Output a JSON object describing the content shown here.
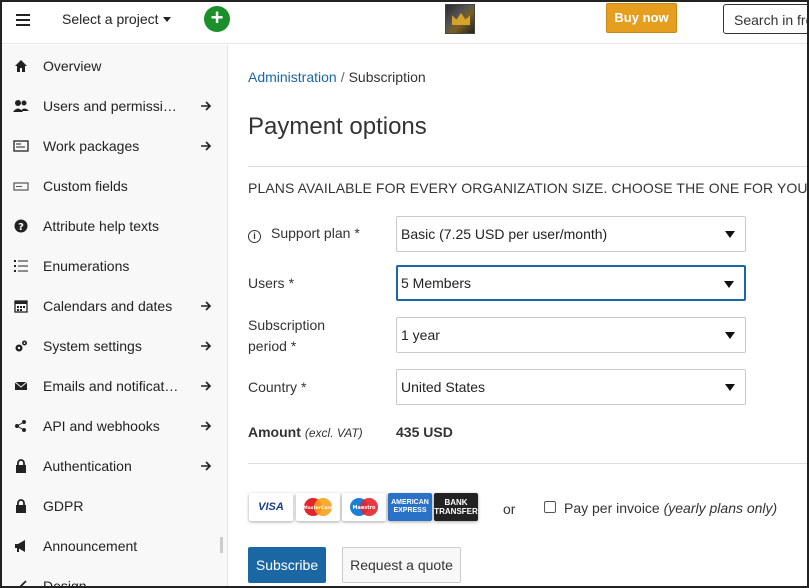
{
  "header": {
    "project_select_label": "Select a project",
    "buy_now_label": "Buy now",
    "search_text": "Search in fre",
    "colors": {
      "add_button": "#1a8f2a",
      "buy_now": "#e69e1f"
    }
  },
  "sidebar": {
    "items": [
      {
        "label": "Overview",
        "icon": "home-icon",
        "has_arrow": false
      },
      {
        "label": "Users and permissi…",
        "icon": "users-icon",
        "has_arrow": true
      },
      {
        "label": "Work packages",
        "icon": "work-packages-icon",
        "has_arrow": true
      },
      {
        "label": "Custom fields",
        "icon": "custom-fields-icon",
        "has_arrow": false
      },
      {
        "label": "Attribute help texts",
        "icon": "help-icon",
        "has_arrow": false
      },
      {
        "label": "Enumerations",
        "icon": "enumeration-icon",
        "has_arrow": false
      },
      {
        "label": "Calendars and dates",
        "icon": "calendar-icon",
        "has_arrow": true
      },
      {
        "label": "System settings",
        "icon": "settings-icon",
        "has_arrow": true
      },
      {
        "label": "Emails and notificat…",
        "icon": "email-icon",
        "has_arrow": true
      },
      {
        "label": "API and webhooks",
        "icon": "api-icon",
        "has_arrow": true
      },
      {
        "label": "Authentication",
        "icon": "lock-icon",
        "has_arrow": true
      },
      {
        "label": "GDPR",
        "icon": "lock-icon",
        "has_arrow": false
      },
      {
        "label": "Announcement",
        "icon": "megaphone-icon",
        "has_arrow": false
      },
      {
        "label": "Design",
        "icon": "design-icon",
        "has_arrow": false
      }
    ]
  },
  "main": {
    "breadcrumb": {
      "parent": "Administration",
      "separator": "/",
      "current": "Subscription"
    },
    "title": "Payment options",
    "section_title": "PLANS AVAILABLE FOR EVERY ORGANIZATION SIZE. CHOOSE THE ONE FOR YOU!",
    "fields": {
      "support_plan": {
        "label": "Support plan",
        "required": "*",
        "value": "Basic (7.25 USD per user/month)"
      },
      "users": {
        "label": "Users",
        "required": "*",
        "value": "5 Members"
      },
      "subscription_period": {
        "label_line1": "Subscription",
        "label_line2": "period",
        "required": "*",
        "value": "1 year"
      },
      "country": {
        "label": "Country",
        "required": "*",
        "value": "United States"
      }
    },
    "amount": {
      "label": "Amount",
      "note": "(excl. VAT)",
      "value": "435 USD"
    },
    "payment_methods": {
      "visa": "VISA",
      "mastercard": "MasterCard",
      "maestro": "Maestro",
      "amex_line1": "AMERICAN",
      "amex_line2": "EXPRESS",
      "bank_line1": "BANK",
      "bank_line2": "TRANSFER"
    },
    "or_text": "or",
    "invoice": {
      "label": "Pay per invoice",
      "note": "(yearly plans only)"
    },
    "buttons": {
      "subscribe": "Subscribe",
      "quote": "Request a quote"
    },
    "colors": {
      "primary": "#1a67a3"
    }
  }
}
